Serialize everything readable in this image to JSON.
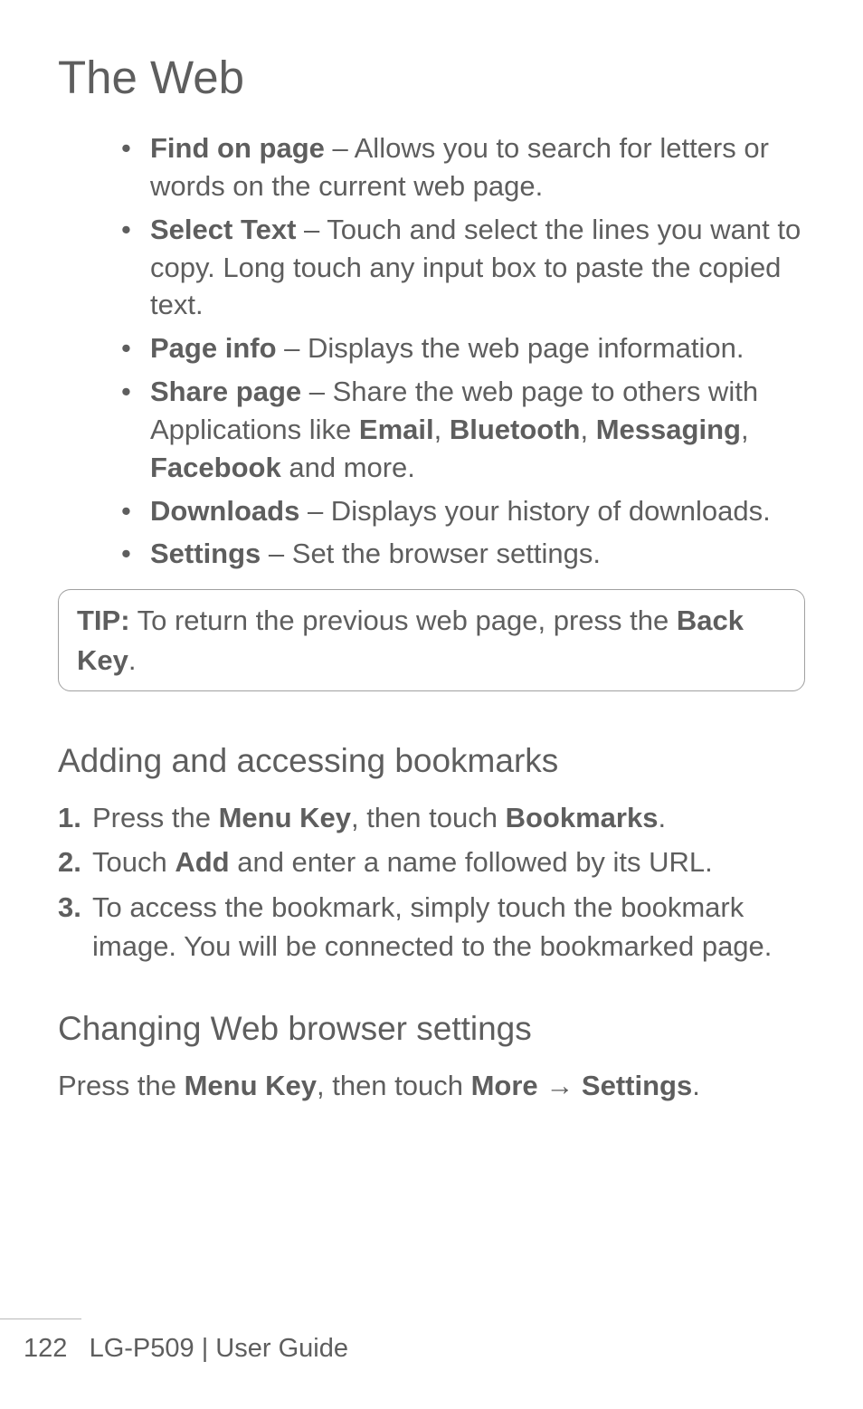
{
  "title": "The Web",
  "bullets": [
    {
      "term": "Find on page",
      "desc": " – Allows you to search for letters or words on the current web page."
    },
    {
      "term": "Select Text",
      "desc": " – Touch and select the lines you want to copy. Long touch any input box to paste the copied text."
    },
    {
      "term": "Page info",
      "desc": " – Displays the web page information."
    }
  ],
  "share_bullet": {
    "term": "Share page",
    "pre": " – Share the web page to others with Applications like ",
    "b1": "Email",
    "c1": ", ",
    "b2": "Bluetooth",
    "c2": ", ",
    "b3": "Messaging",
    "c3": ", ",
    "b4": "Facebook",
    "post": " and more."
  },
  "bullets_tail": [
    {
      "term": "Downloads",
      "desc": " – Displays your history of downloads."
    },
    {
      "term": "Settings",
      "desc": " – Set the browser settings."
    }
  ],
  "tip": {
    "label": "TIP:",
    "pre": " To return the previous web page, press the ",
    "key": "Back Key",
    "post": "."
  },
  "section_bookmarks": {
    "heading": "Adding and accessing bookmarks",
    "step1": {
      "num": "1.",
      "pre": " Press the ",
      "b1": "Menu Key",
      "mid": ", then touch ",
      "b2": "Bookmarks",
      "post": "."
    },
    "step2": {
      "num": "2.",
      "pre": "Touch ",
      "b1": "Add",
      "post": " and enter a name followed by its URL."
    },
    "step3": {
      "num": "3.",
      "text": "To access the bookmark, simply touch the bookmark image. You will be connected to the bookmarked page."
    }
  },
  "section_settings": {
    "heading": "Changing Web browser settings",
    "pre": "Press the ",
    "b1": "Menu Key",
    "mid": ", then touch ",
    "b2": "More",
    "arrow": " → ",
    "b3": "Settings",
    "post": "."
  },
  "footer": {
    "page": "122",
    "model": "LG-P509",
    "sep": "  |  ",
    "guide": "User Guide"
  }
}
